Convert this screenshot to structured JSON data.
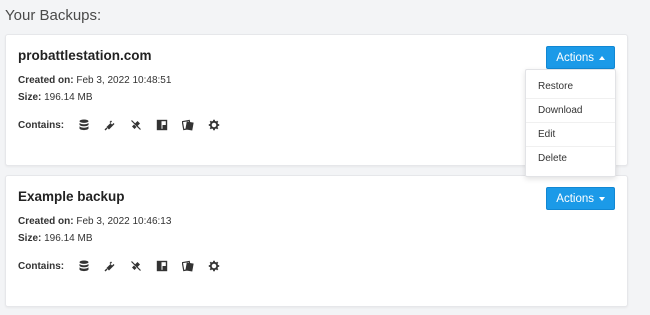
{
  "heading": "Your Backups:",
  "labels": {
    "created": "Created on:",
    "size": "Size:",
    "contains": "Contains:",
    "actions": "Actions"
  },
  "backups": [
    {
      "name": "probattlestation.com",
      "created": "Feb 3, 2022 10:48:51",
      "size": "196.14 MB",
      "menu_open": true
    },
    {
      "name": "Example backup",
      "created": "Feb 3, 2022 10:46:13",
      "size": "196.14 MB",
      "menu_open": false
    }
  ],
  "contains_icons": [
    "database-icon",
    "plugin-icon",
    "plug-disconnected-icon",
    "layout-icon",
    "theme-files-icon",
    "gear-icon"
  ],
  "actions_menu": [
    "Restore",
    "Download",
    "Edit",
    "Delete"
  ],
  "colors": {
    "accent": "#1b9ae8",
    "background": "#f3f4f6",
    "card": "#ffffff"
  }
}
